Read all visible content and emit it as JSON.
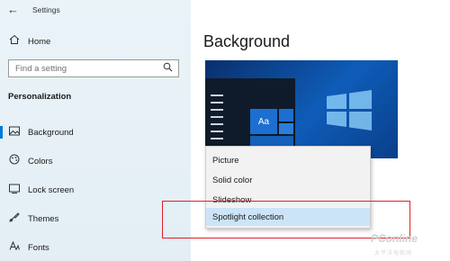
{
  "window": {
    "title": "Settings",
    "back_glyph": "←"
  },
  "sidebar": {
    "home_label": "Home",
    "search_placeholder": "Find a setting",
    "section_title": "Personalization",
    "items": [
      {
        "label": "Background",
        "icon": "image-icon"
      },
      {
        "label": "Colors",
        "icon": "palette-icon"
      },
      {
        "label": "Lock screen",
        "icon": "lock-screen-icon"
      },
      {
        "label": "Themes",
        "icon": "themes-icon"
      },
      {
        "label": "Fonts",
        "icon": "fonts-icon"
      }
    ]
  },
  "main": {
    "heading": "Background",
    "preview_sample_text": "Aa",
    "dropdown_options": [
      "Picture",
      "Solid color",
      "Slideshow",
      "Spotlight collection"
    ],
    "selected_option": "Spotlight collection"
  },
  "watermark": {
    "brand": "PConline",
    "sub": "太平洋电脑网"
  },
  "colors": {
    "accent": "#0078d7",
    "highlight": "#cce4f7",
    "annotation_red": "#e0202a"
  }
}
